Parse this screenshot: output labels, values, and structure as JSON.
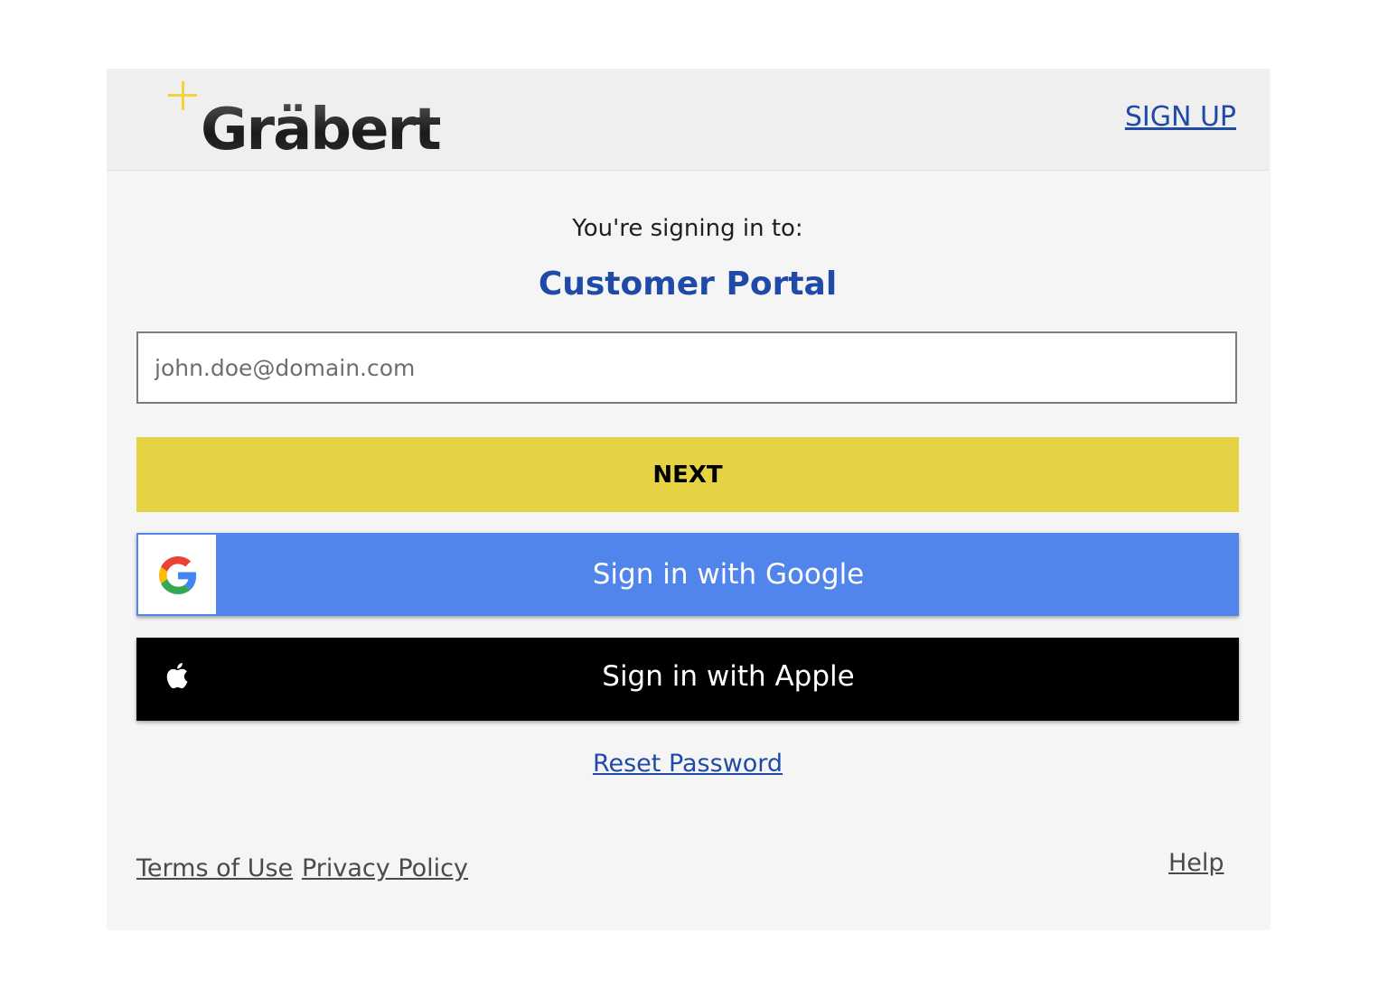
{
  "header": {
    "logo_text": "Gräbert",
    "signup_label": "SIGN UP"
  },
  "main": {
    "signing_in_to": "You're signing in to:",
    "portal_name": "Customer Portal",
    "email_placeholder": "john.doe@domain.com",
    "email_value": "",
    "next_label": "NEXT",
    "google_label": "Sign in with Google",
    "apple_label": "Sign in with Apple",
    "reset_label": "Reset Password"
  },
  "footer": {
    "terms_label": "Terms of Use",
    "privacy_label": "Privacy Policy",
    "help_label": "Help"
  },
  "colors": {
    "accent_yellow": "#e5d343",
    "link_blue": "#1f4aa8",
    "google_blue": "#5185ec",
    "apple_black": "#000000"
  },
  "icons": {
    "logo_plus": "plus-icon",
    "google": "google-icon",
    "apple": "apple-icon"
  }
}
